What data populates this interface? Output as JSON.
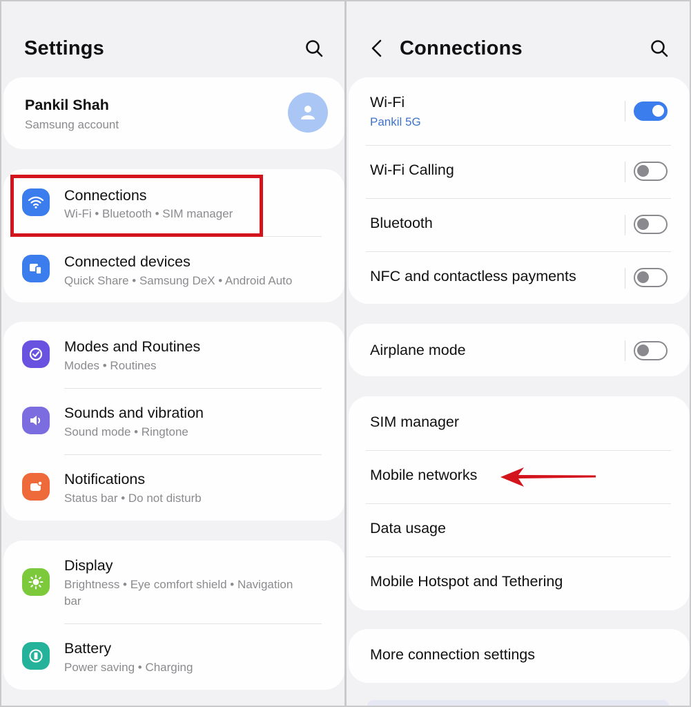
{
  "left_panel": {
    "title": "Settings",
    "account": {
      "name": "Pankil Shah",
      "subtitle": "Samsung account"
    },
    "groups": [
      [
        {
          "icon": "wifi-icon",
          "color": "#3b7ded",
          "label": "Connections",
          "subtitle": "Wi-Fi  •  Bluetooth  •  SIM manager"
        },
        {
          "icon": "connected-devices-icon",
          "color": "#3b7ded",
          "label": "Connected devices",
          "subtitle": "Quick Share  •  Samsung DeX  •  Android Auto"
        }
      ],
      [
        {
          "icon": "modes-routines-icon",
          "color": "#6a52e0",
          "label": "Modes and Routines",
          "subtitle": "Modes  •  Routines"
        },
        {
          "icon": "speaker-icon",
          "color": "#7b6ce0",
          "label": "Sounds and vibration",
          "subtitle": "Sound mode  •  Ringtone"
        },
        {
          "icon": "notifications-icon",
          "color": "#ef6a3a",
          "label": "Notifications",
          "subtitle": "Status bar  •  Do not disturb"
        }
      ],
      [
        {
          "icon": "brightness-icon",
          "color": "#7cc93c",
          "label": "Display",
          "subtitle_line1": "Brightness  •  Eye comfort shield  •  Navigation",
          "subtitle_line2": "bar"
        },
        {
          "icon": "battery-icon",
          "color": "#24b39a",
          "label": "Battery",
          "subtitle": "Power saving  •  Charging"
        }
      ]
    ]
  },
  "right_panel": {
    "title": "Connections",
    "group1": [
      {
        "label": "Wi-Fi",
        "subtitle": "Pankil 5G",
        "toggle_on": true
      },
      {
        "label": "Wi-Fi Calling",
        "toggle_on": false
      },
      {
        "label": "Bluetooth",
        "toggle_on": false
      },
      {
        "label": "NFC and contactless payments",
        "toggle_on": false
      }
    ],
    "group2": [
      {
        "label": "Airplane mode",
        "toggle_on": false
      }
    ],
    "group3": [
      {
        "label": "SIM manager"
      },
      {
        "label": "Mobile networks"
      },
      {
        "label": "Data usage"
      },
      {
        "label": "Mobile Hotspot and Tethering"
      }
    ],
    "group4": [
      {
        "label": "More connection settings"
      }
    ]
  },
  "annotation_color": "#d3141c"
}
